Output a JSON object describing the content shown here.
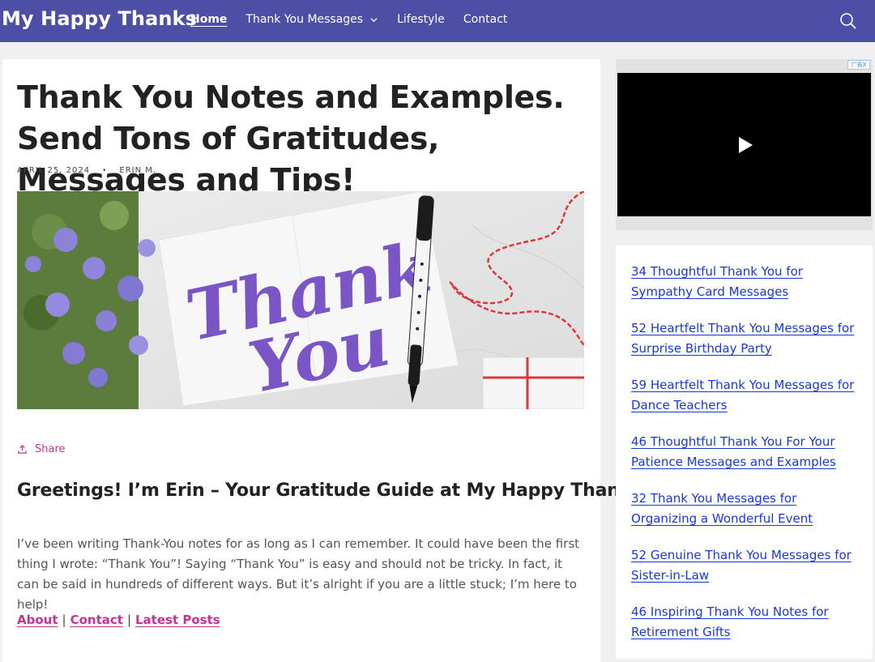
{
  "header": {
    "brand": "My Happy Thanks",
    "nav": [
      {
        "label": "Home"
      },
      {
        "label": "Thank You Messages"
      },
      {
        "label": "Lifestyle"
      },
      {
        "label": "Contact"
      }
    ],
    "search_icon": "search-icon",
    "chevron_icon": "chevron-down-icon"
  },
  "article": {
    "title": "Thank You Notes and Examples. Send Tons of Gratitudes, Messages and Tips!",
    "date": "APRIL 25, 2024",
    "bullet": "•",
    "author": "ERIN M.",
    "hero_text_line1": "Thank",
    "hero_text_line2": "You",
    "share_label": "Share",
    "heading": "Greetings! I’m Erin – Your Gratitude Guide at My Happy Thanks!",
    "intro": "I’ve been writing Thank-You notes for as long as I can remember. It could have been the first thing I wrote: “Thank You”! Saying “Thank You” is easy and should not be tricky. In fact, it can be said in hundreds of different ways. But it’s alright if you are a little stuck; I’m here to help!",
    "links": [
      "About",
      "Contact",
      "Latest Posts"
    ],
    "link_sep": "|"
  },
  "sidebar": {
    "ad_label": "广告",
    "ad_close": "X",
    "posts": [
      "34 Thoughtful Thank You for Sympathy Card Messages",
      "52 Heartfelt Thank You Messages for Surprise Birthday Party",
      "59 Heartfelt Thank You Messages for Dance Teachers",
      "46 Thoughtful Thank You For Your Patience Messages and Examples",
      "32 Thank You Messages for Organizing a Wonderful Event",
      "52 Genuine Thank You Messages for Sister-in-Law",
      "46 Inspiring Thank You Notes for Retirement Gifts"
    ]
  },
  "colors": {
    "header_bg": "#4d4fa6",
    "accent_pink": "#c2358f",
    "link_blue": "#1a39d2",
    "page_bg": "#f0f0f0"
  }
}
